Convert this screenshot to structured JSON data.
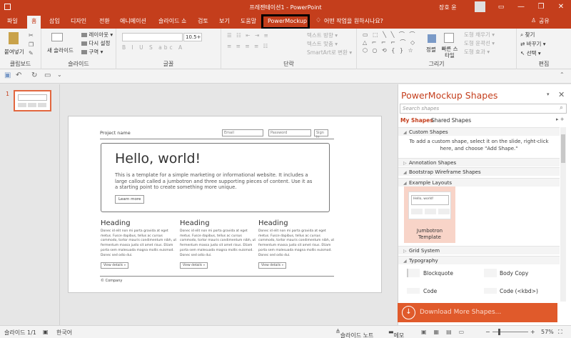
{
  "window": {
    "title": "프레젠테이션1 - PowerPoint",
    "user": "장호 윤",
    "minimize": "—",
    "restore": "❐",
    "close": "✕"
  },
  "tabs": [
    "파일",
    "홈",
    "삽입",
    "디자인",
    "전환",
    "애니메이션",
    "슬라이드 쇼",
    "검토",
    "보기",
    "도움말",
    "PowerMockup"
  ],
  "tell_me": "어떤 작업을 원하시나요?",
  "share": "공유",
  "ribbon": {
    "clipboard": {
      "label": "클립보드",
      "paste": "붙여넣기"
    },
    "slides": {
      "label": "슬라이드",
      "new_slide": "새 슬라이드",
      "layout": "레이아웃",
      "reset": "다시 설정",
      "section": "구역"
    },
    "font": {
      "label": "글꼴",
      "size": "10.5+"
    },
    "paragraph": {
      "label": "단락",
      "text_dir": "텍스트 방향",
      "align_text": "텍스트 맞춤",
      "smartart": "SmartArt로 변환"
    },
    "drawing": {
      "label": "그리기",
      "arrange": "정렬",
      "quick_styles": "빠른 스타일",
      "fill": "도형 채우기",
      "outline": "도형 윤곽선",
      "effects": "도형 효과"
    },
    "editing": {
      "label": "편집",
      "find": "찾기",
      "replace": "바꾸기",
      "select": "선택"
    }
  },
  "thumbnails": {
    "slide_number": "1"
  },
  "slide": {
    "project_name": "Project name",
    "email_placeholder": "Email",
    "password_placeholder": "Password",
    "signin": "Sign in",
    "hero_title": "Hello, world!",
    "hero_body": "This is a template for a simple marketing or informational website. It includes a large callout called a jumbotron and three supporting pieces of content. Use it as a starting point to create something more unique.",
    "learn_more": "Learn more",
    "columns": [
      {
        "heading": "Heading",
        "body": "Donec id elit non mi porta gravida at eget metus. Fusce dapibus, tellus ac cursus commodo, tortor mauris condimentum nibh, ut fermentum massa justo sit amet risus. Etiam porta sem malesuada magna mollis euismod. Donec sed odio dui.",
        "button": "View details »"
      },
      {
        "heading": "Heading",
        "body": "Donec id elit non mi porta gravida at eget metus. Fusce dapibus, tellus ac cursus commodo, tortor mauris condimentum nibh, ut fermentum massa justo sit amet risus. Etiam porta sem malesuada magna mollis euismod. Donec sed odio dui.",
        "button": "View details »"
      },
      {
        "heading": "Heading",
        "body": "Donec id elit non mi porta gravida at eget metus. Fusce dapibus, tellus ac cursus commodo, tortor mauris condimentum nibh, ut fermentum massa justo sit amet risus. Etiam porta sem malesuada magna mollis euismod. Donec sed odio dui.",
        "button": "View details »"
      }
    ],
    "footer": "© Company"
  },
  "pane": {
    "title": "PowerMockup Shapes",
    "search_placeholder": "Search shapes",
    "tabs": [
      "My Shapes",
      "Shared Shapes"
    ],
    "custom_shapes": "Custom Shapes",
    "custom_hint": "To add a custom shape, select it on the slide, right-click here, and choose \"Add Shape.\"",
    "annotation_shapes": "Annotation Shapes",
    "bootstrap": "Bootstrap Wireframe Shapes",
    "example_layouts": "Example Layouts",
    "jumbotron_label": "Jumbotron Template",
    "jumbotron_thumb_text": "Hello, world!",
    "grid_system": "Grid System",
    "typography": "Typography",
    "items": [
      "Blockquote",
      "Body Copy",
      "Code",
      "Code (<kbd>)"
    ],
    "download": "Download More Shapes..."
  },
  "status": {
    "slide_of": "슬라이드 1/1",
    "language": "한국어",
    "notes": "슬라이드 노트",
    "comments": "메모",
    "zoom": "57%"
  },
  "colors": {
    "accent": "#c43e1c",
    "download": "#e05a2b",
    "thumb_border": "#e2673f"
  }
}
